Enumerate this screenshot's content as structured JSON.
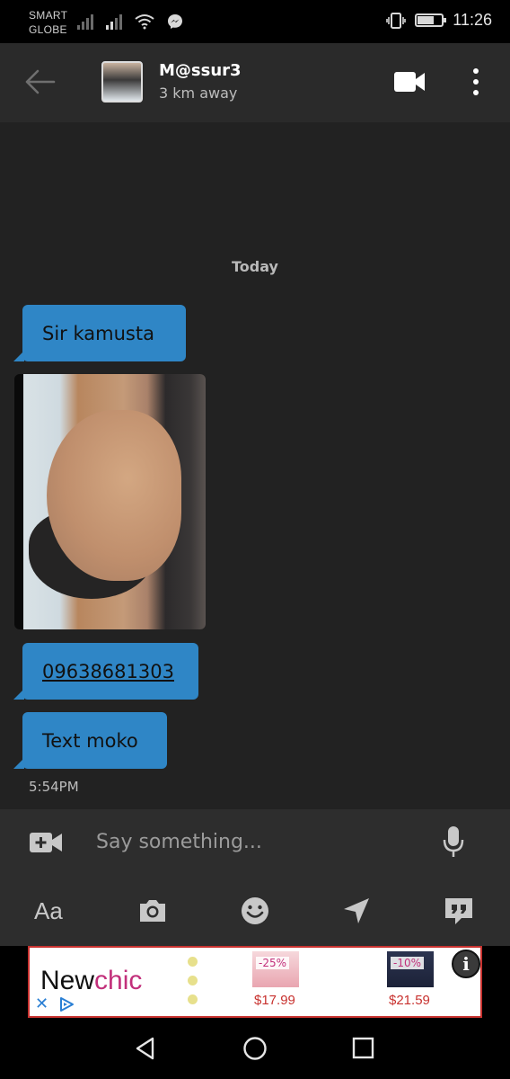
{
  "status_bar": {
    "carrier_line1": "SMART",
    "carrier_line2": "GLOBE",
    "time": "11:26",
    "battery_level": 0.7,
    "icons": [
      "signal-icon",
      "signal-icon",
      "wifi-icon",
      "messenger-icon",
      "vibrate-icon",
      "battery-icon"
    ]
  },
  "header": {
    "back_icon": "arrow-left-icon",
    "contact_name": "M@ssur3",
    "contact_distance": "3 km away",
    "video_icon": "video-camera-icon",
    "more_icon": "more-vert-icon"
  },
  "chat": {
    "day_label": "Today",
    "messages": [
      {
        "type": "text",
        "text": "Sir kamusta"
      },
      {
        "type": "image"
      },
      {
        "type": "link",
        "text": "09638681303"
      },
      {
        "type": "text",
        "text": "Text moko"
      }
    ],
    "last_time": "5:54PM"
  },
  "composer": {
    "placeholder": "Say something...",
    "tools": [
      "Aa",
      "camera-icon",
      "emoji-icon",
      "location-icon",
      "quote-icon"
    ],
    "text_format_label": "Aa"
  },
  "ad": {
    "brand_prefix": "New",
    "brand_highlight": "chic",
    "products": [
      {
        "discount": "-25%",
        "price": "$17.99"
      },
      {
        "discount": "-10%",
        "price": "$21.59"
      }
    ],
    "info_label": "i",
    "close_label": "✕"
  },
  "colors": {
    "accent": "#2f86c6",
    "background": "#222222",
    "header": "#2a2a2a"
  }
}
